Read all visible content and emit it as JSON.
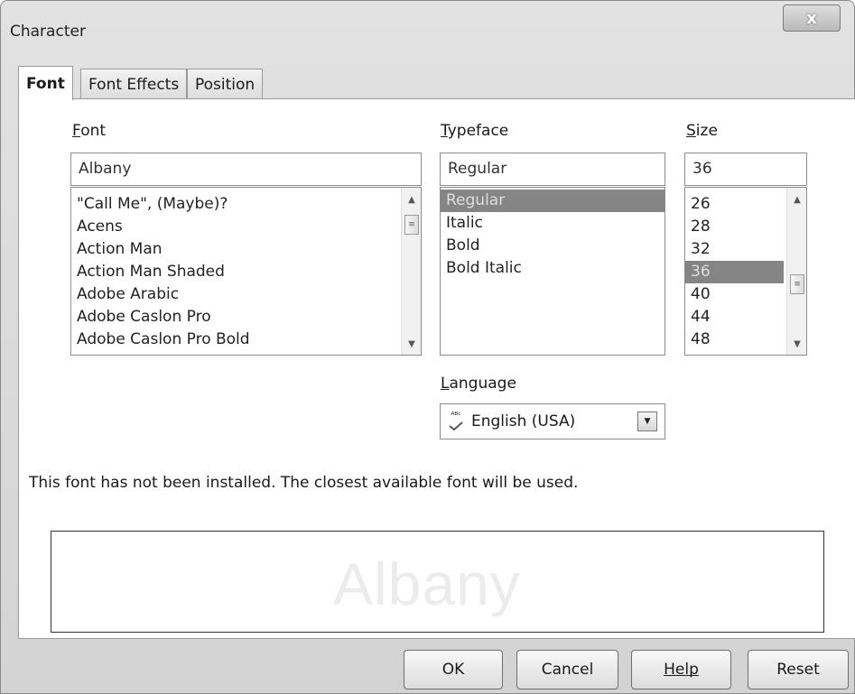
{
  "window": {
    "title": "Character",
    "close_label": "x"
  },
  "tabs": [
    {
      "label": "Font",
      "active": true
    },
    {
      "label": "Font Effects",
      "active": false
    },
    {
      "label": "Position",
      "active": false
    }
  ],
  "font": {
    "label": "Font",
    "value": "Albany",
    "items": [
      "\"Call Me\", (Maybe)?",
      "Acens",
      "Action Man",
      "Action Man Shaded",
      "Adobe Arabic",
      "Adobe Caslon Pro",
      "Adobe Caslon Pro Bold"
    ]
  },
  "typeface": {
    "label": "Typeface",
    "value": "Regular",
    "items": [
      "Regular",
      "Italic",
      "Bold",
      "Bold Italic"
    ],
    "selected": "Regular"
  },
  "size": {
    "label": "Size",
    "value": "36",
    "items": [
      "26",
      "28",
      "32",
      "36",
      "40",
      "44",
      "48"
    ],
    "selected": "36"
  },
  "language": {
    "label": "Language",
    "value": "English (USA)",
    "icon": "spellcheck-abc-icon"
  },
  "warning": "This font has not been installed. The closest available font will be used.",
  "preview": {
    "text": "Albany"
  },
  "buttons": {
    "ok": "OK",
    "cancel": "Cancel",
    "help": "Help",
    "reset": "Reset"
  },
  "icons": {
    "scroll_up": "▲",
    "scroll_down": "▼",
    "scroll_grip": "≡",
    "dropdown": "▼",
    "abc": "ᴬᴮᶜ"
  }
}
